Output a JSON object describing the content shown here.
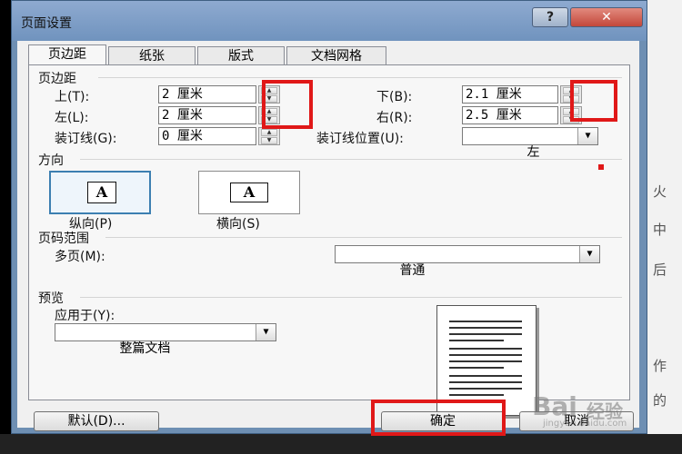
{
  "window": {
    "title": "页面设置",
    "help_label": "?",
    "close_label": "✕"
  },
  "tabs": [
    {
      "label": "页边距"
    },
    {
      "label": "纸张"
    },
    {
      "label": "版式"
    },
    {
      "label": "文档网格"
    }
  ],
  "margins": {
    "section_label": "页边距",
    "top": {
      "label": "上(T):",
      "value": "2 厘米"
    },
    "bottom": {
      "label": "下(B):",
      "value": "2.1 厘米"
    },
    "left": {
      "label": "左(L):",
      "value": "2 厘米"
    },
    "right": {
      "label": "右(R):",
      "value": "2.5 厘米"
    },
    "gutter": {
      "label": "装订线(G):",
      "value": "0 厘米"
    },
    "gutter_position": {
      "label": "装订线位置(U):",
      "value": "左"
    }
  },
  "orientation": {
    "section_label": "方向",
    "portrait_label": "纵向(P)",
    "landscape_label": "横向(S)",
    "icon_letter": "A",
    "selected": "portrait"
  },
  "pages": {
    "section_label": "页码范围",
    "multiple_label": "多页(M):",
    "multiple_value": "普通"
  },
  "preview": {
    "section_label": "预览",
    "apply_label": "应用于(Y):",
    "apply_value": "整篇文档"
  },
  "buttons": {
    "default_label": "默认(D)...",
    "ok_label": "确定",
    "cancel_label": "取消"
  },
  "background_text": [
    "火",
    "中",
    "后",
    "作",
    "的"
  ],
  "watermark": {
    "brand": "Bai",
    "brand2": "经验",
    "url": "jingyan.baidu.com"
  },
  "colors": {
    "highlight": "#e01818",
    "title_bar": "#7093be",
    "dialog": "#f0f0f0"
  }
}
